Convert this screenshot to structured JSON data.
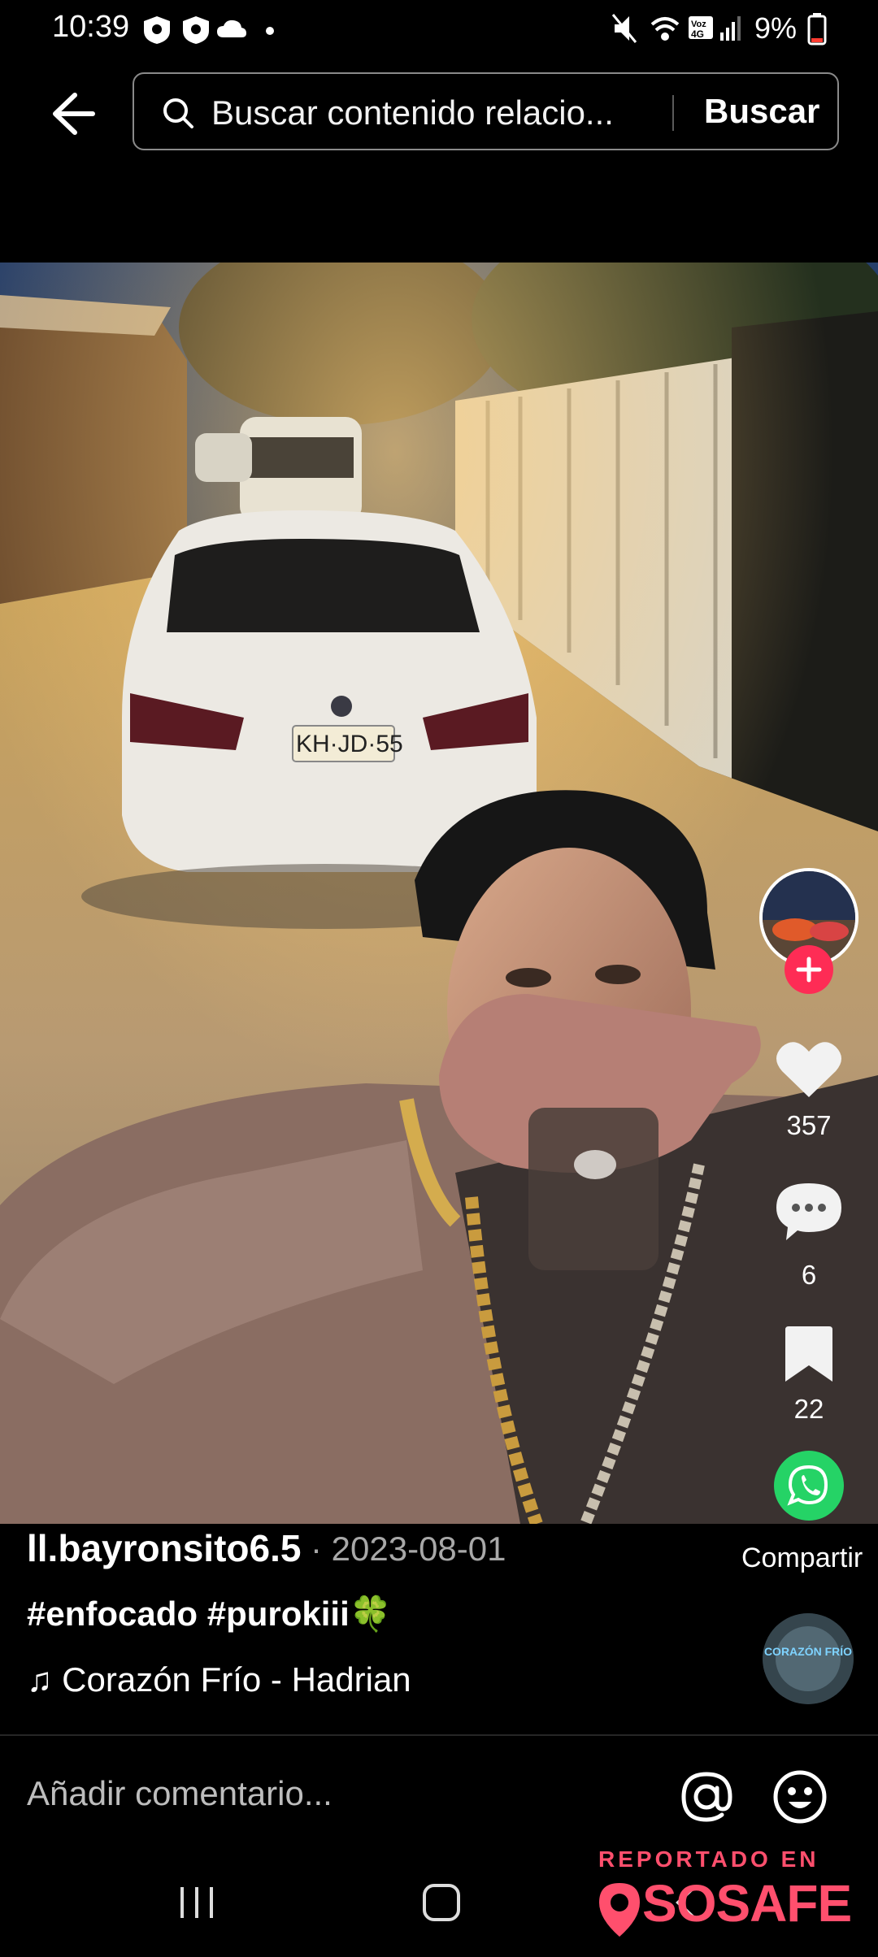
{
  "status_bar": {
    "time": "10:39",
    "net_label": "Voz 4G",
    "battery": "9%"
  },
  "search": {
    "placeholder": "Buscar contenido relacio...",
    "button_label": "Buscar"
  },
  "post": {
    "username": "ll.bayronsito6.5",
    "date": "· 2023-08-01",
    "caption": "#enfocado #purokiii🍀",
    "music": "♫ Corazón Frío - Hadrian",
    "likes": "357",
    "comments": "6",
    "saves": "22",
    "share_label": "Compartir",
    "license_plate": "KH·JD·55",
    "disc_text": "CORAZÓN FRÍO"
  },
  "comment_bar": {
    "placeholder": "Añadir comentario..."
  },
  "watermark": {
    "top": "REPORTADO EN",
    "brand": "SOSAFE"
  },
  "colors": {
    "accent_red": "#fe2c55",
    "whatsapp_green": "#25d366",
    "watermark_pink": "#ff4f6d"
  },
  "icons": [
    "back-arrow-icon",
    "search-icon",
    "heart-icon",
    "comment-icon",
    "bookmark-icon",
    "whatsapp-icon",
    "plus-icon",
    "at-icon",
    "emoji-icon",
    "music-note-icon"
  ]
}
